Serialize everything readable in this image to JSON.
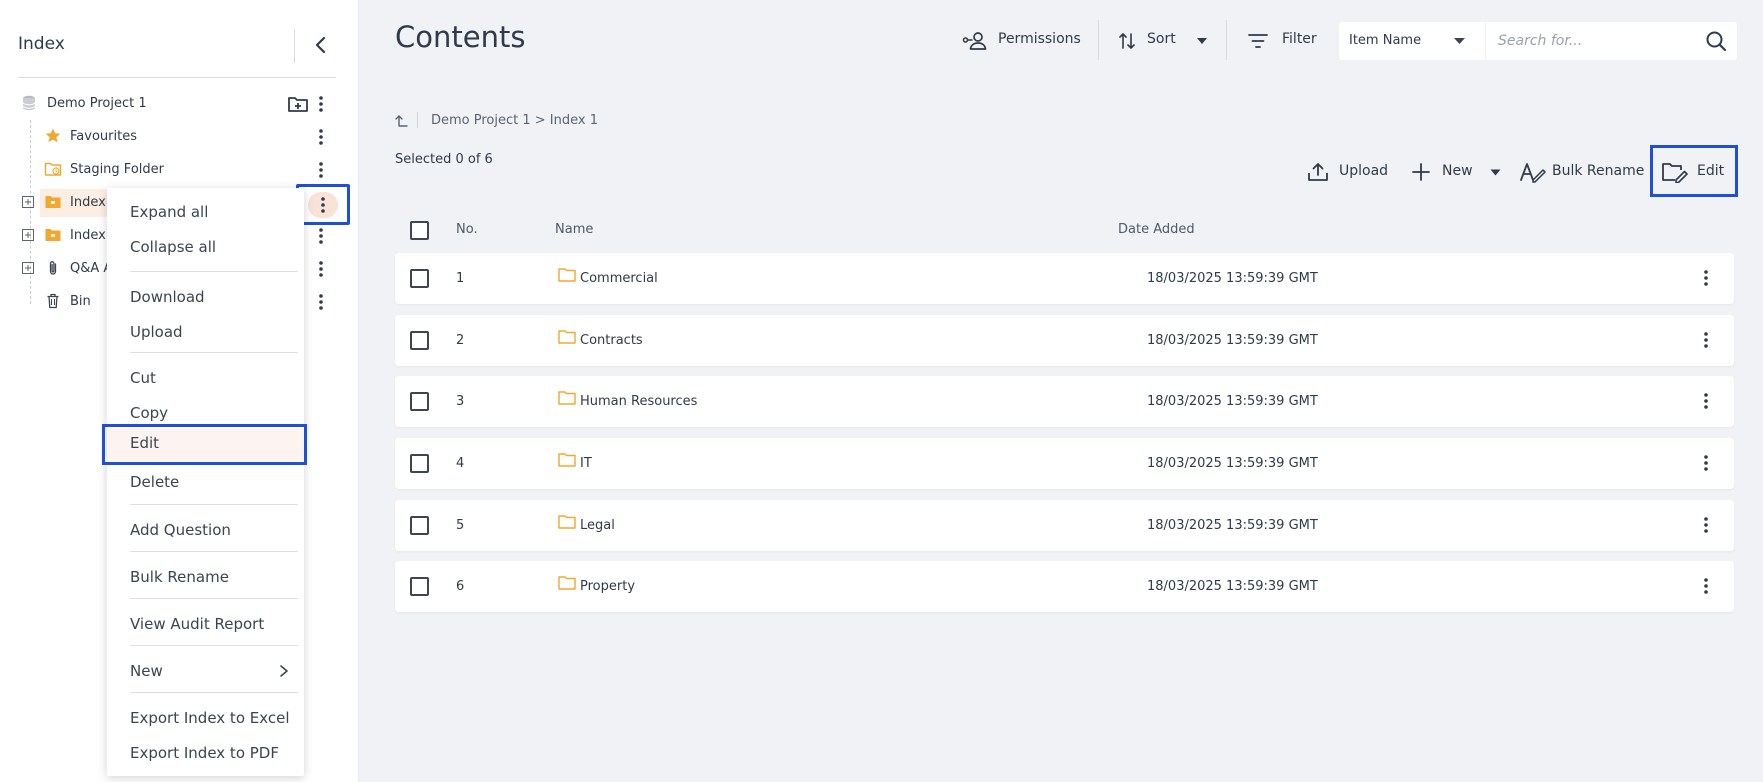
{
  "sidebar": {
    "title": "Index",
    "tree": [
      {
        "label": "Demo Project 1"
      },
      {
        "label": "Favourites"
      },
      {
        "label": "Staging Folder"
      },
      {
        "label": "Index"
      },
      {
        "label": "Index"
      },
      {
        "label": "Q&A A"
      },
      {
        "label": "Bin"
      }
    ]
  },
  "context_menu": {
    "items": [
      "Expand all",
      "Collapse all",
      "Download",
      "Upload",
      "Cut",
      "Copy",
      "Edit",
      "Delete",
      "Add Question",
      "Bulk Rename",
      "View Audit Report",
      "New",
      "Export Index to Excel",
      "Export Index to PDF"
    ]
  },
  "header": {
    "title": "Contents",
    "permissions": "Permissions",
    "sort": "Sort",
    "filter": "Filter",
    "filter_field": "Item Name",
    "search_placeholder": "Search for..."
  },
  "breadcrumb": "Demo Project 1 > Index 1",
  "selection": "Selected 0 of 6",
  "actions": {
    "upload": "Upload",
    "new": "New",
    "bulk_rename": "Bulk Rename",
    "edit": "Edit"
  },
  "table": {
    "columns": [
      "No.",
      "Name",
      "Date Added"
    ],
    "rows": [
      {
        "no": "1",
        "name": "Commercial",
        "date": "18/03/2025 13:59:39 GMT"
      },
      {
        "no": "2",
        "name": "Contracts",
        "date": "18/03/2025 13:59:39 GMT"
      },
      {
        "no": "3",
        "name": "Human Resources",
        "date": "18/03/2025 13:59:39 GMT"
      },
      {
        "no": "4",
        "name": "IT",
        "date": "18/03/2025 13:59:39 GMT"
      },
      {
        "no": "5",
        "name": "Legal",
        "date": "18/03/2025 13:59:39 GMT"
      },
      {
        "no": "6",
        "name": "Property",
        "date": "18/03/2025 13:59:39 GMT"
      }
    ]
  },
  "colors": {
    "highlight_border": "#1e50d7",
    "folder": "#f0a830",
    "background": "#f1f2f5"
  }
}
